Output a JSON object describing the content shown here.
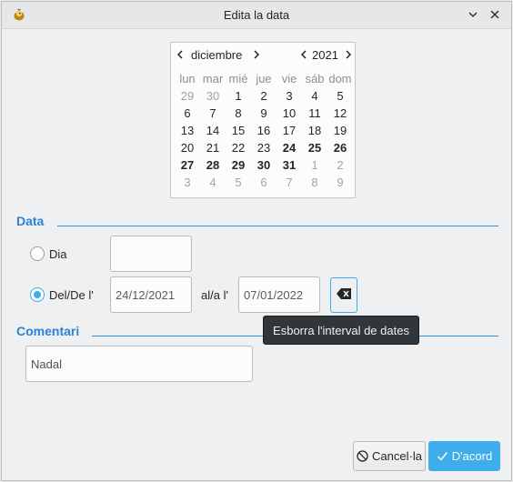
{
  "window": {
    "title": "Edita la data"
  },
  "calendar": {
    "month": "diciembre",
    "year": "2021",
    "weekdays": [
      "lun",
      "mar",
      "mié",
      "jue",
      "vie",
      "sáb",
      "dom"
    ],
    "weeks": [
      [
        "29",
        "30",
        "1",
        "2",
        "3",
        "4",
        "5"
      ],
      [
        "6",
        "7",
        "8",
        "9",
        "10",
        "11",
        "12"
      ],
      [
        "13",
        "14",
        "15",
        "16",
        "17",
        "18",
        "19"
      ],
      [
        "20",
        "21",
        "22",
        "23",
        "24",
        "25",
        "26"
      ],
      [
        "27",
        "28",
        "29",
        "30",
        "31",
        "1",
        "2"
      ],
      [
        "3",
        "4",
        "5",
        "6",
        "7",
        "8",
        "9"
      ]
    ]
  },
  "data_section": {
    "heading": "Data",
    "day_option": {
      "label": "Dia",
      "checked": false,
      "value": ""
    },
    "range_option": {
      "label": "Del/De l'",
      "checked": true
    },
    "from_value": "24/12/2021",
    "to_label": "al/a l'",
    "to_value": "07/01/2022"
  },
  "tooltip": {
    "text": "Esborra l'interval de dates"
  },
  "comment_section": {
    "heading": "Comentari",
    "value": "Nadal"
  },
  "buttons": {
    "cancel_label": "Cancel·la",
    "ok_label": "D'acord"
  },
  "colors": {
    "accent": "#3daee9",
    "heading": "#2a83d6",
    "tooltip_bg": "#31363b"
  },
  "icons": {
    "app": "chicken-icon",
    "minimize": "chevron-down-icon",
    "close": "close-icon",
    "clear": "backspace-icon",
    "cancel": "cancel-icon",
    "ok": "check-icon"
  }
}
